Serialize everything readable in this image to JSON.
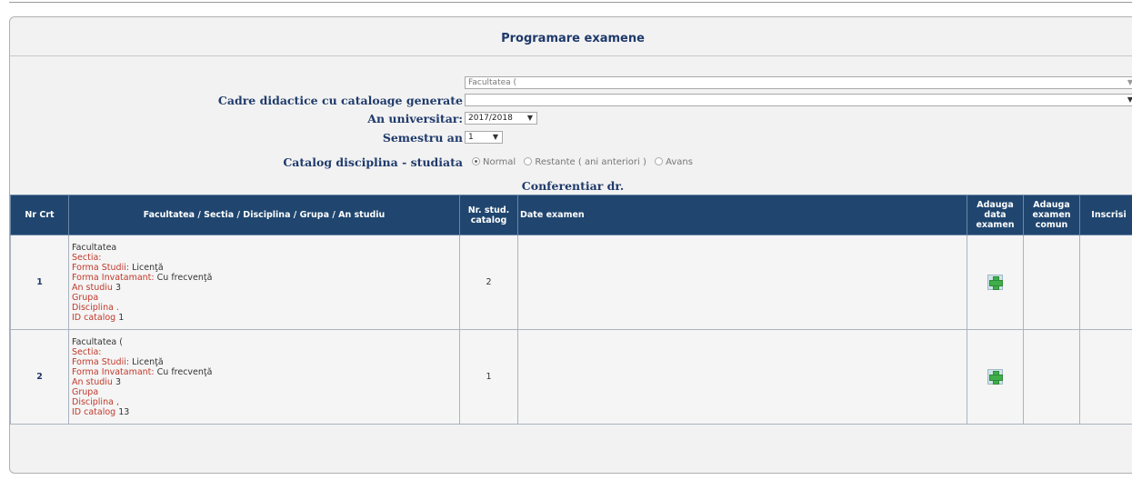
{
  "page": {
    "title": "Programare examene"
  },
  "filters": {
    "facultate_select": {
      "value": "Facultatea (",
      "label": ""
    },
    "cadre_select": {
      "label": "Cadre didactice cu cataloage generate",
      "value": ""
    },
    "an_universitar": {
      "label": "An universitar:",
      "value": "2017/2018"
    },
    "semestru": {
      "label": "Semestru an",
      "value": "1"
    },
    "catalog": {
      "label": "Catalog disciplina - studiata",
      "options": [
        {
          "label": "Normal",
          "checked": true
        },
        {
          "label": "Restante ( ani anteriori )",
          "checked": false
        },
        {
          "label": "Avans",
          "checked": false
        }
      ]
    }
  },
  "rank": "Conferentiar dr.",
  "table": {
    "headers": {
      "nr_crt": "Nr Crt",
      "path": "Facultatea / Sectia / Disciplina / Grupa / An studiu",
      "nr_stud": "Nr. stud. catalog",
      "date_examen": "Date examen",
      "adauga_data": "Adauga data examen",
      "adauga_comun": "Adauga examen comun",
      "inscrisi": "Inscrisi"
    },
    "rows": [
      {
        "nr": "1",
        "facultatea": "Facultatea",
        "sectia_label": "Sectia:",
        "forma_studii_label": "Forma Studii:",
        "forma_studii_value": "Licenţă",
        "forma_inv_label": "Forma Invatamant:",
        "forma_inv_value": "Cu frecvenţă",
        "an_studiu_label": "An studiu",
        "an_studiu_value": "3",
        "grupa_label": "Grupa",
        "disciplina_label": "Disciplina .",
        "id_catalog_label": "ID catalog",
        "id_catalog_value": "1",
        "nr_stud": "2"
      },
      {
        "nr": "2",
        "facultatea": "Facultatea (",
        "sectia_label": "Sectia:",
        "forma_studii_label": "Forma Studii:",
        "forma_studii_value": "Licenţă",
        "forma_inv_label": "Forma Invatamant:",
        "forma_inv_value": "Cu frecvenţă",
        "an_studiu_label": "An studiu",
        "an_studiu_value": "3",
        "grupa_label": "Grupa",
        "disciplina_label": "Disciplina ,",
        "id_catalog_label": "ID catalog",
        "id_catalog_value": "13",
        "nr_stud": "1"
      }
    ]
  },
  "icons": {
    "add": "plus-icon"
  },
  "colors": {
    "header_bg": "#20466f",
    "title": "#1f3a6b",
    "field_label": "#c0392b",
    "add_icon": "#3fae49"
  }
}
